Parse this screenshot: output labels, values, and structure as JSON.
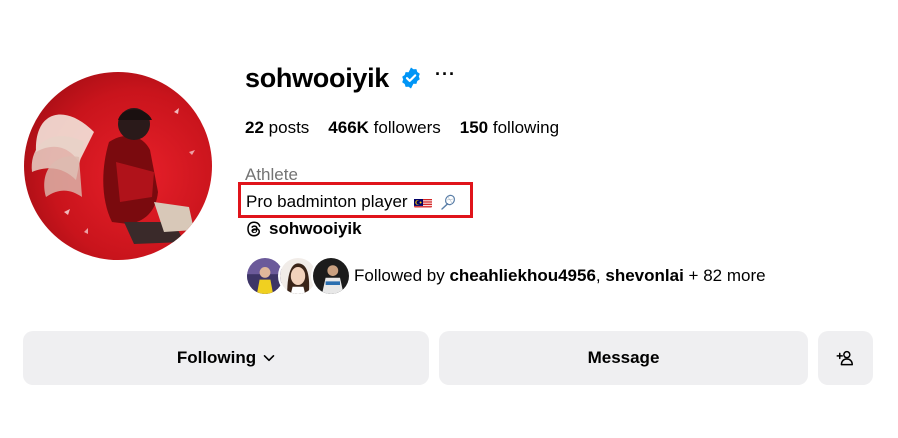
{
  "profile": {
    "username": "sohwooiyik",
    "more_label": "···",
    "stats": {
      "posts_count": "22",
      "posts_label": "posts",
      "followers_count": "466K",
      "followers_label": "followers",
      "following_count": "150",
      "following_label": "following"
    },
    "category": "Athlete",
    "bio": "Pro badminton player",
    "threads_handle": "sohwooiyik",
    "followed_by": {
      "prefix": "Followed by",
      "user1": "cheahliekhou4956",
      "separator": ",",
      "user2": "shevonlai",
      "suffix": "+ 82 more"
    }
  },
  "actions": {
    "following_label": "Following",
    "message_label": "Message"
  },
  "icons": {
    "verified": "verified-badge-icon",
    "more": "more-options-icon",
    "threads": "threads-logo-icon",
    "chevron": "chevron-down-icon",
    "suggest": "add-person-icon",
    "flag": "malaysia-flag-icon",
    "racket": "badminton-racket-icon"
  },
  "colors": {
    "verified_blue": "#0095f6",
    "highlight_red": "#e0141b",
    "button_bg": "#efeff1",
    "muted_text": "#737373"
  }
}
